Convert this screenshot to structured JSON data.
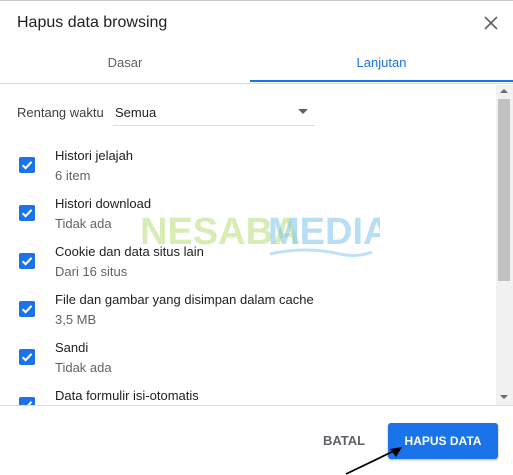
{
  "dialog": {
    "title": "Hapus data browsing"
  },
  "tabs": [
    {
      "label": "Dasar"
    },
    {
      "label": "Lanjutan"
    }
  ],
  "time_range": {
    "label": "Rentang waktu",
    "value": "Semua"
  },
  "items": [
    {
      "title": "Histori jelajah",
      "subtitle": "6 item",
      "checked": true
    },
    {
      "title": "Histori download",
      "subtitle": "Tidak ada",
      "checked": true
    },
    {
      "title": "Cookie dan data situs lain",
      "subtitle": "Dari 16 situs",
      "checked": true
    },
    {
      "title": "File dan gambar yang disimpan dalam cache",
      "subtitle": "3,5 MB",
      "checked": true
    },
    {
      "title": "Sandi",
      "subtitle": "Tidak ada",
      "checked": true
    },
    {
      "title": "Data formulir isi-otomatis",
      "subtitle": "",
      "checked": true
    }
  ],
  "buttons": {
    "cancel": "BATAL",
    "clear": "HAPUS DATA"
  },
  "watermark": {
    "text_left": "NESABA",
    "text_right": "MEDIA"
  },
  "colors": {
    "accent": "#1a73e8",
    "watermark_green": "#b9dd7a",
    "watermark_blue": "#7fc4ee"
  }
}
